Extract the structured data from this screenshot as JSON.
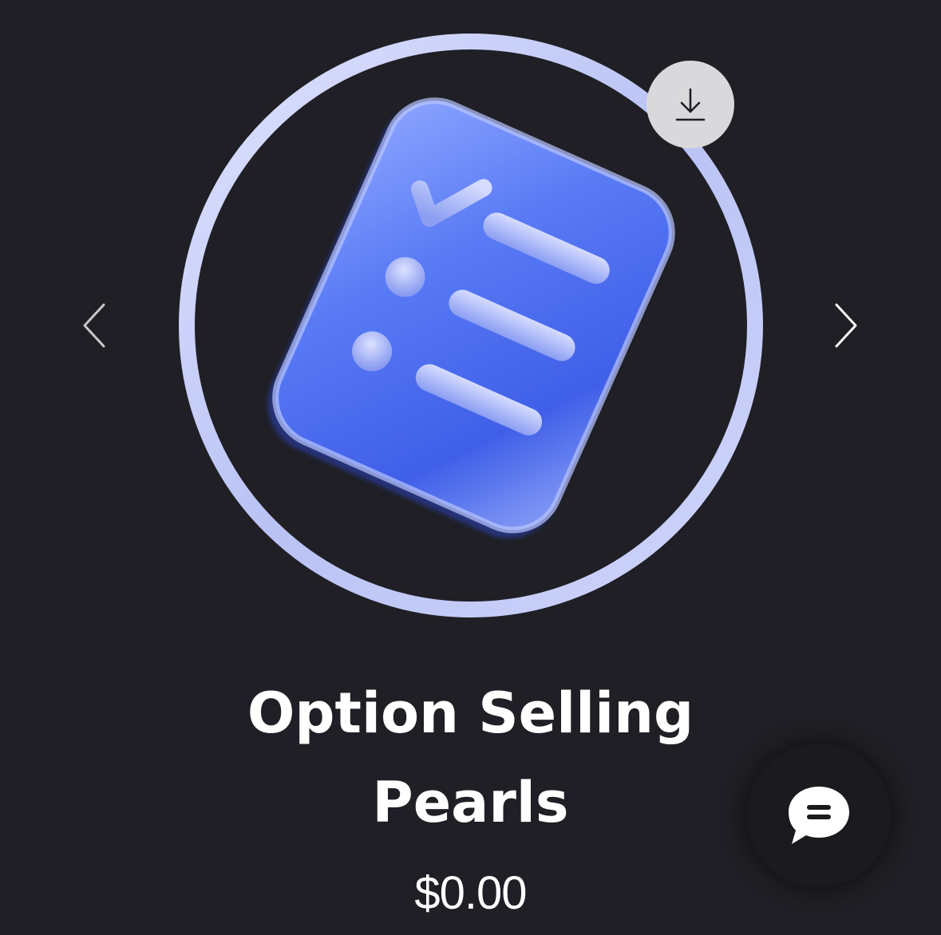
{
  "product": {
    "title_line1": "Option Selling",
    "title_line2": "Pearls",
    "price": "$0.00"
  },
  "icons": {
    "download": "download-icon",
    "prev": "chevron-left-icon",
    "next": "chevron-right-icon",
    "chat": "chat-bubble-icon",
    "product_image": "checklist-icon"
  },
  "colors": {
    "background": "#1f1f25",
    "ring": "#c9cff5",
    "card": "#4f6ff0",
    "text": "#ffffff",
    "download_bg": "#d9d9db"
  }
}
